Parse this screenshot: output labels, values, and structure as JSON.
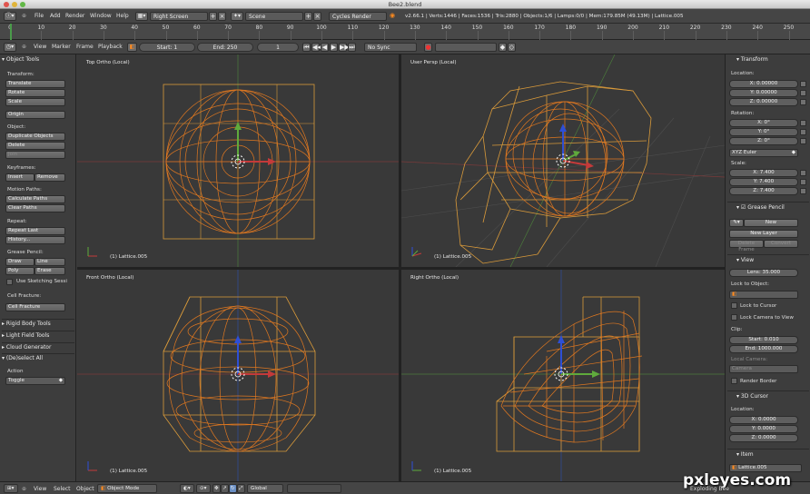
{
  "window": {
    "title": "Bee2.blend"
  },
  "info_header": {
    "menus": [
      "File",
      "Add",
      "Render",
      "Window",
      "Help"
    ],
    "screen": "Right Screen",
    "scene": "Scene",
    "engine": "Cycles Render",
    "stats": "v2.66.1 | Verts:1446 | Faces:1536 | Tris:2880 | Objects:1/6 | Lamps:0/0 | Mem:179.85M (49.13M) | Lattice.005"
  },
  "timeline": {
    "ticks": [
      "0",
      "10",
      "20",
      "30",
      "40",
      "50",
      "60",
      "70",
      "80",
      "90",
      "100",
      "110",
      "120",
      "130",
      "140",
      "150",
      "160",
      "170",
      "180",
      "190",
      "200",
      "210",
      "220",
      "230",
      "240",
      "250"
    ],
    "menus": [
      "View",
      "Marker",
      "Frame",
      "Playback"
    ],
    "start": "Start: 1",
    "end": "End: 250",
    "current": "1",
    "sync": "No Sync"
  },
  "tool_shelf": {
    "header": "Object Tools",
    "transform_label": "Transform:",
    "translate": "Translate",
    "rotate": "Rotate",
    "scale": "Scale",
    "origin": "Origin",
    "object_label": "Object:",
    "duplicate": "Duplicate Objects",
    "delete": "Delete",
    "join": "Join",
    "keyframes_label": "Keyframes:",
    "insert": "Insert",
    "remove": "Remove",
    "motion_label": "Motion Paths:",
    "calc_paths": "Calculate Paths",
    "clear_paths": "Clear Paths",
    "repeat_label": "Repeat:",
    "repeat_last": "Repeat Last",
    "history": "History...",
    "gp_label": "Grease Pencil:",
    "draw": "Draw",
    "line": "Line",
    "poly": "Poly",
    "erase": "Erase",
    "sketching": "Use Sketching Sessi",
    "cell_label": "Cell Fracture:",
    "cell_btn": "Cell Fracture",
    "rigid": "Rigid Body Tools",
    "lightfield": "Light Field Tools",
    "cloud": "Cloud Generator",
    "deselect": "(De)select All",
    "action_label": "Action",
    "action_value": "Toggle"
  },
  "viewports": {
    "top": {
      "label": "Top Ortho (Local)",
      "object": "(1) Lattice.005"
    },
    "persp": {
      "label": "User Persp (Local)",
      "object": "(1) Lattice.005"
    },
    "front": {
      "label": "Front Ortho (Local)",
      "object": "(1) Lattice.005"
    },
    "right": {
      "label": "Right Ortho (Local)",
      "object": "(1) Lattice.005"
    }
  },
  "properties": {
    "transform_header": "Transform",
    "location_label": "Location:",
    "loc_x": "X: 0.00000",
    "loc_y": "Y: 0.00000",
    "loc_z": "Z: 0.00000",
    "rotation_label": "Rotation:",
    "rot_x": "X: 0°",
    "rot_y": "Y: 0°",
    "rot_z": "Z: 0°",
    "rot_mode": "XYZ Euler",
    "scale_label": "Scale:",
    "scale_x": "X: 7.400",
    "scale_y": "Y: 7.400",
    "scale_z": "Z: 7.400",
    "gp_header": "Grease Pencil",
    "gp_new": "New",
    "gp_new_layer": "New Layer",
    "gp_delete_frame": "Delete Frame",
    "gp_convert": "Convert",
    "view_header": "View",
    "lens": "Lens: 35.000",
    "lock_object_label": "Lock to Object:",
    "lock_cursor": "Lock to Cursor",
    "lock_camera": "Lock Camera to View",
    "clip_label": "Clip:",
    "clip_start": "Start: 0.010",
    "clip_end": "End: 1000.000",
    "local_camera_label": "Local Camera:",
    "camera": "Camera",
    "render_border": "Render Border",
    "cursor_header": "3D Cursor",
    "cursor_location_label": "Location:",
    "cur_x": "X: 0.0000",
    "cur_y": "Y: 0.0000",
    "cur_z": "Z: 0.0000",
    "item_header": "Item",
    "item_name": "Lattice.005"
  },
  "statusbar": {
    "menus": [
      "View",
      "Select",
      "Object"
    ],
    "mode": "Object Mode",
    "orientation": "Global"
  },
  "watermark": {
    "text": "pxleyes.com",
    "sub": "Exploding Bee"
  },
  "colors": {
    "accent": "#ff8a1e",
    "lattice": "#d99a3a",
    "axis_x": "#c43a3a",
    "axis_y": "#5faa3c",
    "axis_z": "#2e4fd6"
  }
}
